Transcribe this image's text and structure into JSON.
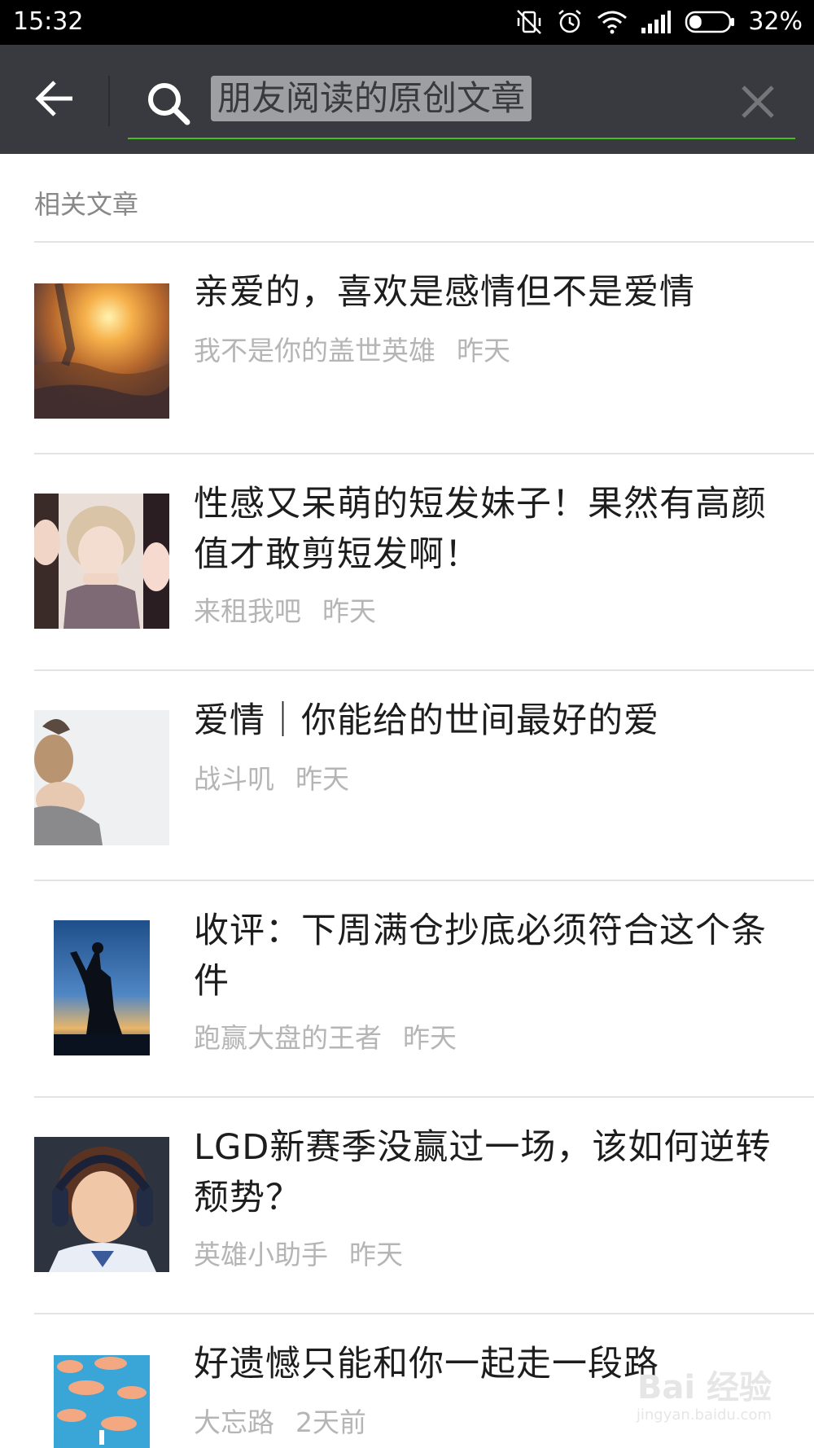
{
  "status_bar": {
    "time": "15:32",
    "battery_percent_text": "32%",
    "battery_level": 0.32,
    "icons": [
      "vibrate-off-icon",
      "alarm-icon",
      "wifi-icon",
      "signal-icon",
      "battery-icon"
    ]
  },
  "toolbar": {
    "search_value": "朋友阅读的原创文章",
    "accent_color": "#45c01a",
    "background_color": "#393a3f"
  },
  "section": {
    "header": "相关文章"
  },
  "articles": [
    {
      "title": "亲爱的，喜欢是感情但不是爱情",
      "author": "我不是你的盖世英雄",
      "time": "昨天"
    },
    {
      "title": "性感又呆萌的短发妹子！果然有高颜值才敢剪短发啊！",
      "author": "来租我吧",
      "time": "昨天"
    },
    {
      "title": "爱情｜你能给的世间最好的爱",
      "author": "战斗叽",
      "time": "昨天"
    },
    {
      "title": "收评：下周满仓抄底必须符合这个条件",
      "author": "跑赢大盘的王者",
      "time": "昨天"
    },
    {
      "title": "LGD新赛季没赢过一场，该如何逆转颓势？",
      "author": "英雄小助手",
      "time": "昨天"
    },
    {
      "title": "好遗憾只能和你一起走一段路",
      "author": "大忘路",
      "time": "2天前"
    }
  ],
  "watermark": {
    "text": "Bai 经验",
    "sub": "jingyan.baidu.com"
  }
}
